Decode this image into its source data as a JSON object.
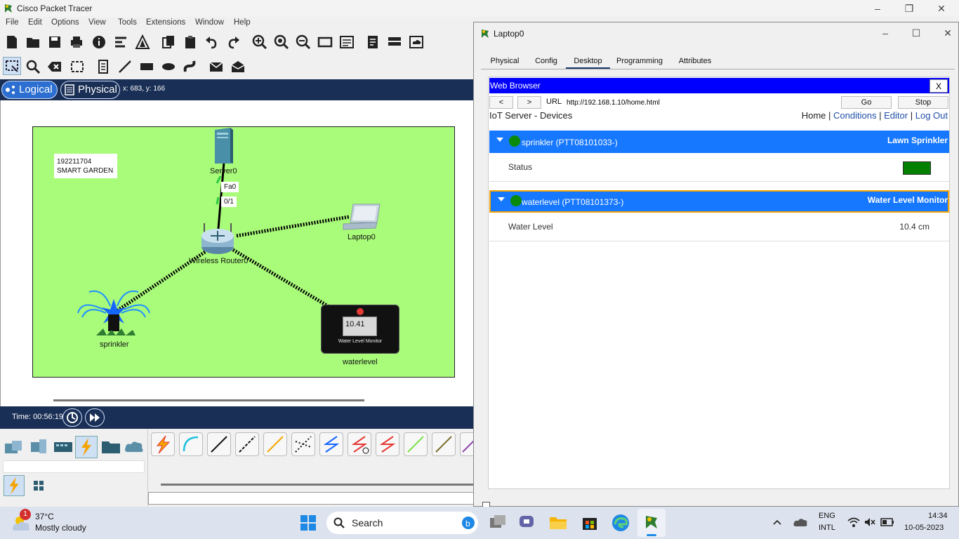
{
  "app": {
    "title": "Cisco Packet Tracer",
    "menu": [
      "File",
      "Edit",
      "Options",
      "View",
      "Tools",
      "Extensions",
      "Window",
      "Help"
    ]
  },
  "modes": {
    "logical": "Logical",
    "physical": "Physical",
    "coords": "x: 683, y: 166"
  },
  "workspace": {
    "note_line1": "192211704",
    "note_line2": "SMART GARDEN",
    "devices": {
      "server": "Server0",
      "router": "Wireless Router0",
      "laptop": "Laptop0",
      "sprinkler": "sprinkler",
      "waterlevel": "waterlevel"
    },
    "port_top": "Fa0",
    "port_bottom": "0/1",
    "monitor_display": "10.41",
    "monitor_label": "Water Level Monitor"
  },
  "simulation": {
    "time": "Time: 00:56:19"
  },
  "laptop_window": {
    "title": "Laptop0",
    "tabs": [
      "Physical",
      "Config",
      "Desktop",
      "Programming",
      "Attributes"
    ],
    "active_tab": "Desktop"
  },
  "browser": {
    "header": "Web Browser",
    "close": "X",
    "back": "<",
    "forward": ">",
    "url_label": "URL",
    "url": "http://192.168.1.10/home.html",
    "go": "Go",
    "stop": "Stop",
    "page_title": "IoT Server - Devices",
    "nav": {
      "home": "Home",
      "sep": "|",
      "conditions": "Conditions",
      "editor": "Editor",
      "logout": "Log Out"
    },
    "devices": [
      {
        "name": "sprinkler (PTT08101033-)",
        "kind": "Lawn Sprinkler",
        "prop_label": "Status",
        "status_color": "#007f00"
      },
      {
        "name": "waterlevel (PTT08101373-)",
        "kind": "Water Level Monitor",
        "prop_label": "Water Level",
        "prop_value": "10.4 cm"
      }
    ]
  },
  "taskbar": {
    "notification_count": "1",
    "temp": "37°C",
    "weather": "Mostly cloudy",
    "search": "Search",
    "lang1": "ENG",
    "lang2": "INTL",
    "time": "14:34",
    "date": "10-05-2023"
  },
  "colors": {
    "garden_bg": "#a9fb7a",
    "mode_bar": "#1a2f55",
    "browser_header": "#0000ff",
    "device_header": "#1677ff",
    "online_dot": "#0a8a0a"
  }
}
